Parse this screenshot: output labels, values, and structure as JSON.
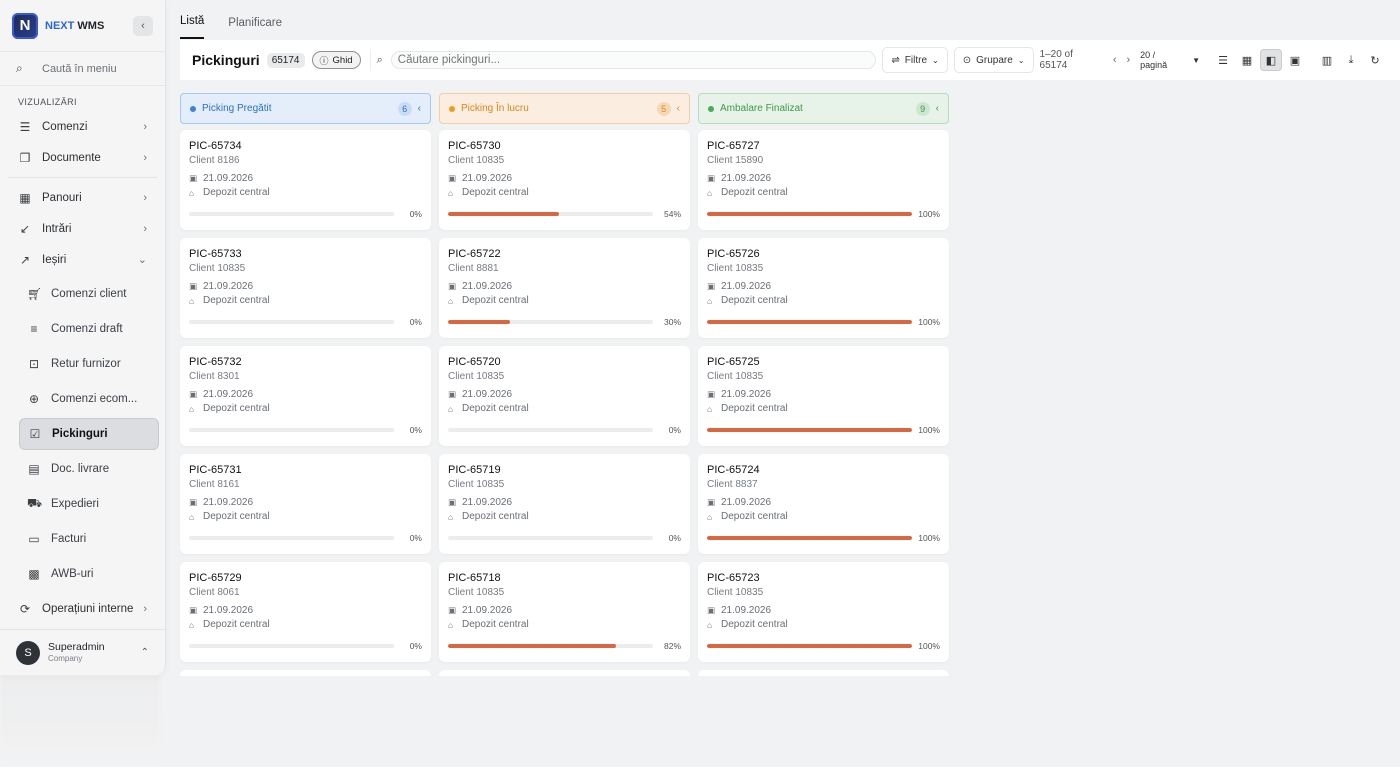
{
  "brand": {
    "logo_letter": "N",
    "name_accent": "NEXT",
    "name_rest": " WMS"
  },
  "sidebar": {
    "search_placeholder": "Caută în meniu",
    "section_label": "VIZUALIZĂRI",
    "group1": [
      {
        "label": "Comenzi",
        "icon": "list-icon"
      },
      {
        "label": "Documente",
        "icon": "documents-icon"
      }
    ],
    "group2": [
      {
        "label": "Panouri",
        "icon": "dashboard-icon"
      },
      {
        "label": "Intrări",
        "icon": "arrow-down-left-icon"
      },
      {
        "label": "Ieșiri",
        "icon": "arrow-up-right-icon"
      }
    ],
    "sub_items": [
      {
        "label": "Comenzi client",
        "icon": "cart-icon"
      },
      {
        "label": "Comenzi draft",
        "icon": "draft-icon"
      },
      {
        "label": "Retur furnizor",
        "icon": "return-icon"
      },
      {
        "label": "Comenzi ecom...",
        "icon": "globe-icon"
      },
      {
        "label": "Pickinguri",
        "icon": "checklist-icon"
      },
      {
        "label": "Doc. livrare",
        "icon": "document-icon"
      },
      {
        "label": "Expedieri",
        "icon": "truck-icon"
      },
      {
        "label": "Facturi",
        "icon": "invoice-icon"
      },
      {
        "label": "AWB-uri",
        "icon": "qr-icon"
      }
    ],
    "bottom_item": {
      "label": "Operațiuni interne",
      "icon": "operations-icon"
    },
    "user": {
      "initial": "S",
      "name": "Superadmin",
      "role": "Company"
    }
  },
  "tabs": [
    {
      "label": "Listă"
    },
    {
      "label": "Planificare"
    }
  ],
  "header": {
    "title": "Pickinguri",
    "count": "65174",
    "guide_label": "Ghid",
    "search_placeholder": "Căutare pickinguri...",
    "filter_label": "Filtre",
    "group_label": "Grupare",
    "range_text": "1–20 of 65174",
    "per_page": "20 / pagină"
  },
  "columns": [
    {
      "title": "Picking Pregătit",
      "count": "6",
      "theme": "blue",
      "cards": [
        {
          "code": "PIC-65734",
          "client": "Client 8186",
          "date": "21.09.2026",
          "warehouse": "Depozit central",
          "progress": 0
        },
        {
          "code": "PIC-65733",
          "client": "Client 10835",
          "date": "21.09.2026",
          "warehouse": "Depozit central",
          "progress": 0
        },
        {
          "code": "PIC-65732",
          "client": "Client 8301",
          "date": "21.09.2026",
          "warehouse": "Depozit central",
          "progress": 0
        },
        {
          "code": "PIC-65731",
          "client": "Client 8161",
          "date": "21.09.2026",
          "warehouse": "Depozit central",
          "progress": 0
        },
        {
          "code": "PIC-65729",
          "client": "Client 8061",
          "date": "21.09.2026",
          "warehouse": "Depozit central",
          "progress": 0
        }
      ]
    },
    {
      "title": "Picking În lucru",
      "count": "5",
      "theme": "orange",
      "cards": [
        {
          "code": "PIC-65730",
          "client": "Client 10835",
          "date": "21.09.2026",
          "warehouse": "Depozit central",
          "progress": 54
        },
        {
          "code": "PIC-65722",
          "client": "Client 8881",
          "date": "21.09.2026",
          "warehouse": "Depozit central",
          "progress": 30
        },
        {
          "code": "PIC-65720",
          "client": "Client 10835",
          "date": "21.09.2026",
          "warehouse": "Depozit central",
          "progress": 0
        },
        {
          "code": "PIC-65719",
          "client": "Client 10835",
          "date": "21.09.2026",
          "warehouse": "Depozit central",
          "progress": 0
        },
        {
          "code": "PIC-65718",
          "client": "Client 10835",
          "date": "21.09.2026",
          "warehouse": "Depozit central",
          "progress": 82
        }
      ]
    },
    {
      "title": "Ambalare Finalizat",
      "count": "9",
      "theme": "green",
      "cards": [
        {
          "code": "PIC-65727",
          "client": "Client 15890",
          "date": "21.09.2026",
          "warehouse": "Depozit central",
          "progress": 100
        },
        {
          "code": "PIC-65726",
          "client": "Client 10835",
          "date": "21.09.2026",
          "warehouse": "Depozit central",
          "progress": 100
        },
        {
          "code": "PIC-65725",
          "client": "Client 10835",
          "date": "21.09.2026",
          "warehouse": "Depozit central",
          "progress": 100
        },
        {
          "code": "PIC-65724",
          "client": "Client 8837",
          "date": "21.09.2026",
          "warehouse": "Depozit central",
          "progress": 100
        },
        {
          "code": "PIC-65723",
          "client": "Client 10835",
          "date": "21.09.2026",
          "warehouse": "Depozit central",
          "progress": 100
        }
      ]
    }
  ],
  "colors": {
    "accent": "#2a66d6",
    "progress": "#d9673f",
    "blue": "#2d70c8",
    "orange": "#d9881a",
    "green": "#3f9a4a"
  }
}
